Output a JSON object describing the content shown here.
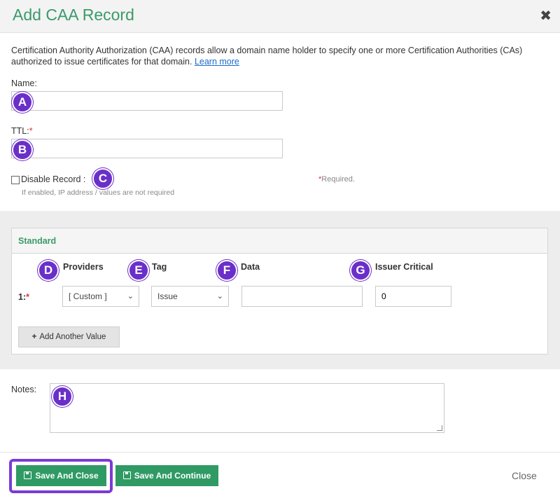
{
  "dialog": {
    "title": "Add CAA Record",
    "close_icon": "✖",
    "description": "Certification Authority Authorization (CAA) records allow a domain name holder to specify one or more Certification Authorities (CAs) authorized to issue certificates for that domain.",
    "learn_more": "Learn more"
  },
  "form": {
    "name_label": "Name:",
    "name_value": "",
    "ttl_label": "TTL:",
    "ttl_required": "*",
    "ttl_value": "",
    "disable_label": "Disable Record :",
    "disable_hint": "If enabled, IP address / values are not required",
    "required_note_star": "*",
    "required_note": "Required."
  },
  "standard": {
    "title": "Standard",
    "columns": {
      "providers": "Providers",
      "tag": "Tag",
      "data": "Data",
      "issuer_critical": "Issuer Critical"
    },
    "row": {
      "index": "1:",
      "required": "*",
      "provider": "[ Custom ]",
      "tag": "Issue",
      "data": "",
      "issuer_critical": "0"
    },
    "add_button": "Add Another Value",
    "add_icon": "+"
  },
  "notes": {
    "label": "Notes:",
    "value": ""
  },
  "footer": {
    "save_close": "Save And Close",
    "save_continue": "Save And Continue",
    "close": "Close"
  },
  "badges": [
    "A",
    "B",
    "C",
    "D",
    "E",
    "F",
    "G",
    "H"
  ],
  "colors": {
    "accent_green": "#3a9a6a",
    "button_green": "#2f9a64",
    "badge_purple": "#6b2fc9",
    "required_red": "#d9343a"
  }
}
